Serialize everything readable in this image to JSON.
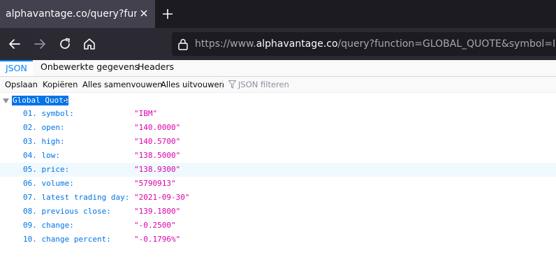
{
  "browser": {
    "tab_title": "alphavantage.co/query?function=GLOBAL_QUOTE&symbol=IBM&apikey",
    "url_scheme": "https://www.",
    "url_domain": "alphavantage.co",
    "url_path": "/query?function=GLOBAL_QUOTE&symbol=IBM&apikey"
  },
  "viewer": {
    "tabs": [
      {
        "label": "JSON",
        "active": true
      },
      {
        "label": "Onbewerkte gegevens",
        "active": false
      },
      {
        "label": "Headers",
        "active": false
      }
    ],
    "toolbar": {
      "save": "Opslaan",
      "copy": "Kopiëren",
      "collapse_all": "Alles samenvouwen",
      "expand_all": "Alles uitvouwen",
      "filter_placeholder": "JSON filteren"
    }
  },
  "json": {
    "root_key": "Global Quote",
    "root_colon": ":",
    "rows": [
      {
        "key": "01. symbol:",
        "value": "\"IBM\""
      },
      {
        "key": "02. open:",
        "value": "\"140.0000\""
      },
      {
        "key": "03. high:",
        "value": "\"140.5700\""
      },
      {
        "key": "04. low:",
        "value": "\"138.5000\""
      },
      {
        "key": "05. price:",
        "value": "\"138.9300\""
      },
      {
        "key": "06. volume:",
        "value": "\"5790913\""
      },
      {
        "key": "07. latest trading day:",
        "value": "\"2021-09-30\""
      },
      {
        "key": "08. previous close:",
        "value": "\"139.1800\""
      },
      {
        "key": "09. change:",
        "value": "\"-0.2500\""
      },
      {
        "key": "10. change percent:",
        "value": "\"-0.1796%\""
      }
    ]
  },
  "colors": {
    "key_blue": "#0074e8",
    "value_magenta": "#dd00a9",
    "accent": "#0a84ff",
    "hover_row": "#f0f9fe"
  }
}
